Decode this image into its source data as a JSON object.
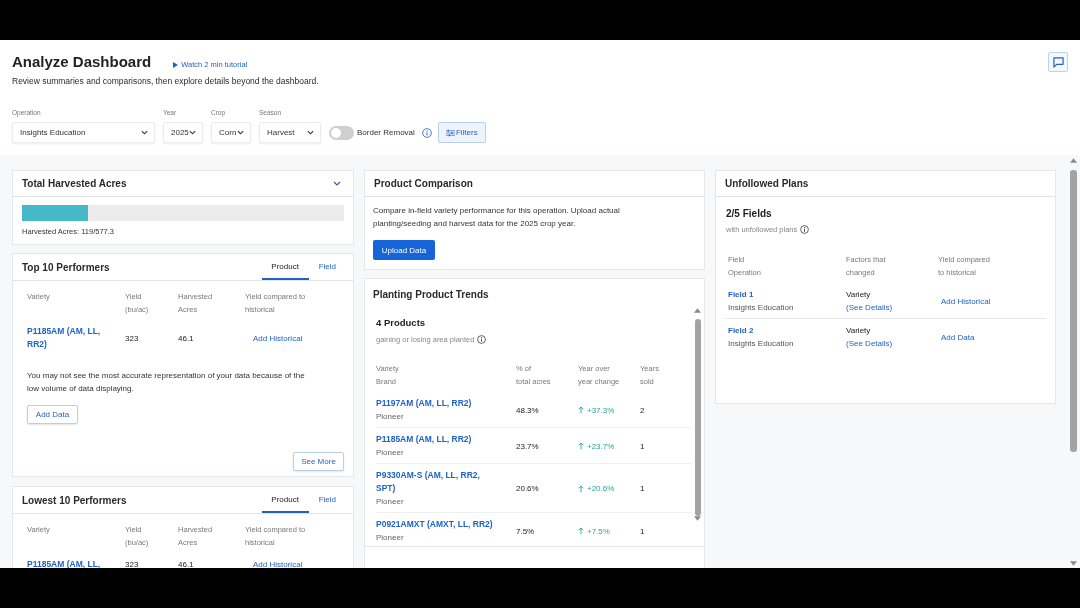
{
  "header": {
    "title": "Analyze Dashboard",
    "tutorial_link": "Watch 2 min tutorial",
    "subtitle": "Review summaries and comparisons, then explore details beyond the dashboard."
  },
  "filters": {
    "selects": [
      {
        "label": "Operation",
        "value": "Insights Education"
      },
      {
        "label": "Year",
        "value": "2025"
      },
      {
        "label": "Crop",
        "value": "Corn"
      },
      {
        "label": "Season",
        "value": "Harvest"
      }
    ],
    "toggle": {
      "label": "Border Removal",
      "on": false
    },
    "button": "Filters"
  },
  "harvested_acres": {
    "title": "Total Harvested Acres",
    "level": 0.206,
    "caption": "Harvested Acres: 119/577.3"
  },
  "performer_cards": [
    {
      "title": "Top 10 Performers",
      "tabs": [
        {
          "label": "Product",
          "selected": true
        },
        {
          "label": "Field",
          "selected": false
        }
      ],
      "columns": [
        [
          "Variety"
        ],
        [
          "Yield",
          "(bu/ac)"
        ],
        [
          "Harvested",
          "Acres"
        ],
        [
          "Yield compared to",
          "historical"
        ]
      ],
      "rows": [
        {
          "variety": "P1185AM (AM, LL, RR2)",
          "yield": "323",
          "acres": "46.1",
          "action": "Add Historical"
        }
      ],
      "note": "You may not see the most accurate representation of your data because of the low volume of data displaying.",
      "add_button": "Add Data",
      "see_more": "See More"
    },
    {
      "title": "Lowest 10 Performers",
      "tabs": [
        {
          "label": "Product",
          "selected": true
        },
        {
          "label": "Field",
          "selected": false
        }
      ],
      "columns": [
        [
          "Variety"
        ],
        [
          "Yield",
          "(bu/ac)"
        ],
        [
          "Harvested",
          "Acres"
        ],
        [
          "Yield compared to",
          "historical"
        ]
      ],
      "rows": [
        {
          "variety": "P1185AM (AM, LL,",
          "yield": "323",
          "acres": "46.1",
          "action": "Add Historical"
        }
      ]
    }
  ],
  "product_comparison": {
    "title": "Product Comparison",
    "description": "Compare in-field variety performance for this operation. Upload actual planting/seeding and harvest data for the 2025 crop year.",
    "button": "Upload Data"
  },
  "planting_trends": {
    "title": "Planting Product Trends",
    "count": "4 Products",
    "caption": "gaining or losing area planted",
    "columns": [
      [
        "Variety",
        "Brand"
      ],
      [
        "% of",
        "total acres"
      ],
      [
        "Year over",
        "year change"
      ],
      [
        "Years",
        "sold"
      ]
    ],
    "rows": [
      {
        "product": "P1197AM (AM, LL, RR2)",
        "brand": "Pioneer",
        "share": "48.3%",
        "rising": true,
        "change": "+37.3%",
        "years": "2"
      },
      {
        "product": "P1185AM (AM, LL, RR2)",
        "brand": "Pioneer",
        "share": "23.7%",
        "rising": true,
        "change": "+23.7%",
        "years": "1"
      },
      {
        "product": "P9330AM-S (AM, LL, RR2, SPT)",
        "brand": "Pioneer",
        "share": "20.6%",
        "rising": true,
        "change": "+20.6%",
        "years": "1"
      },
      {
        "product": "P0921AMXT (AMXT, LL, RR2)",
        "brand": "Pioneer",
        "share": "7.5%",
        "rising": true,
        "change": "+7.5%",
        "years": "1"
      }
    ]
  },
  "unfollowed_plans": {
    "title": "Unfollowed Plans",
    "count": "2/5 Fields",
    "caption": "with unfollowed plans",
    "columns": [
      [
        "Field",
        "Operation"
      ],
      [
        "Factors that",
        "changed"
      ],
      [
        "Yield compared",
        "to historical"
      ]
    ],
    "rows": [
      {
        "field": "Field 1",
        "operation": "Insights Education",
        "factor": "Variety",
        "details": "(See Details)",
        "action": "Add Historical"
      },
      {
        "field": "Field 2",
        "operation": "Insights Education",
        "factor": "Variety",
        "details": "(See Details)",
        "action": "Add Data"
      }
    ]
  }
}
